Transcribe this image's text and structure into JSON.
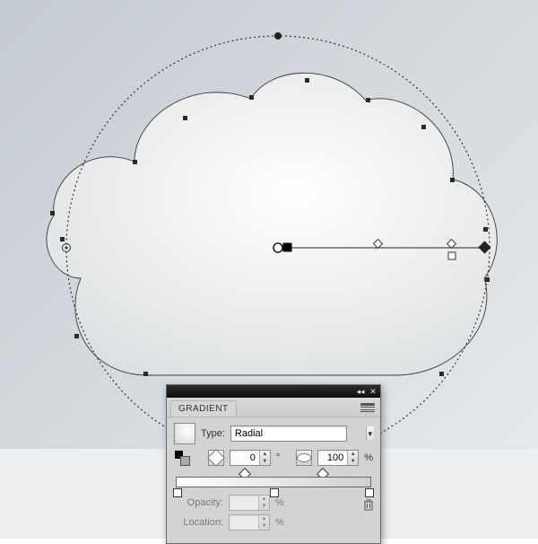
{
  "panel": {
    "title": "GRADIENT",
    "type_label": "Type:",
    "type_value": "Radial",
    "angle_value": "0",
    "angle_unit": "°",
    "angle_spin": "▸",
    "aspect_value": "100",
    "percent": "%",
    "opacity_label": "Opacity:",
    "location_label": "Location:",
    "header": {
      "collapse": "◂◂",
      "close": "✕"
    }
  },
  "gradient": {
    "stops": [
      {
        "position": 0
      },
      {
        "position": 100
      }
    ],
    "midpoints": [
      {
        "position": 35
      },
      {
        "position": 75
      }
    ]
  },
  "annotator": {
    "origin_ratio": 0.52,
    "end_stop_ratio": 0.95
  }
}
